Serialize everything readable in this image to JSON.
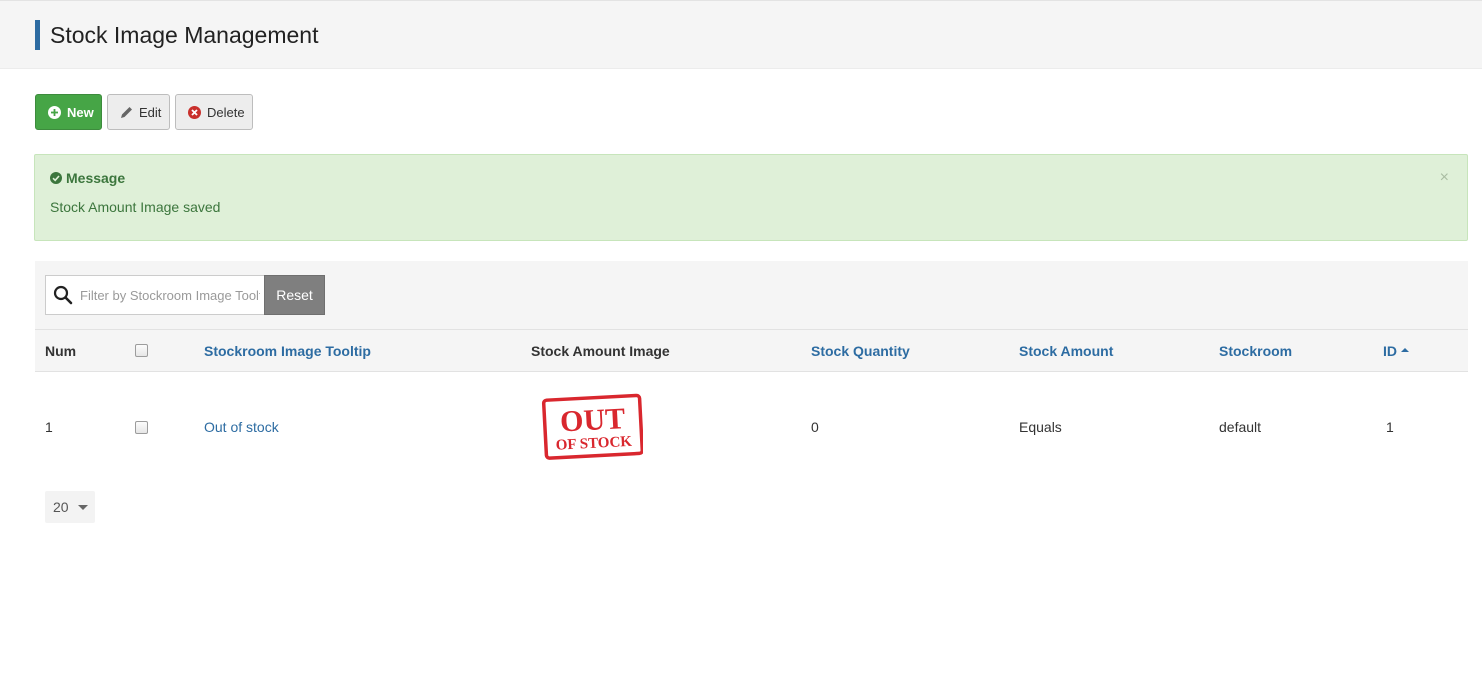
{
  "page": {
    "title": "Stock Image Management"
  },
  "toolbar": {
    "new_label": "New",
    "edit_label": "Edit",
    "delete_label": "Delete"
  },
  "alert": {
    "title": "Message",
    "body": "Stock Amount Image saved",
    "close": "×"
  },
  "filter": {
    "placeholder": "Filter by Stockroom Image Tooltip",
    "reset_label": "Reset"
  },
  "table": {
    "headers": {
      "num": "Num",
      "tooltip": "Stockroom Image Tooltip",
      "image": "Stock Amount Image",
      "quantity": "Stock Quantity",
      "amount": "Stock Amount",
      "stockroom": "Stockroom",
      "id": "ID"
    },
    "rows": [
      {
        "num": "1",
        "tooltip": "Out of stock",
        "image_text_1": "OUT",
        "image_text_2": "OF STOCK",
        "quantity": "0",
        "amount": "Equals",
        "stockroom": "default",
        "id": "1"
      }
    ]
  },
  "pager": {
    "limit": "20"
  },
  "colors": {
    "accent": "#2d6ca2",
    "success": "#46a546",
    "alert_bg": "#dff0d8",
    "stamp_red": "#d9272e"
  }
}
